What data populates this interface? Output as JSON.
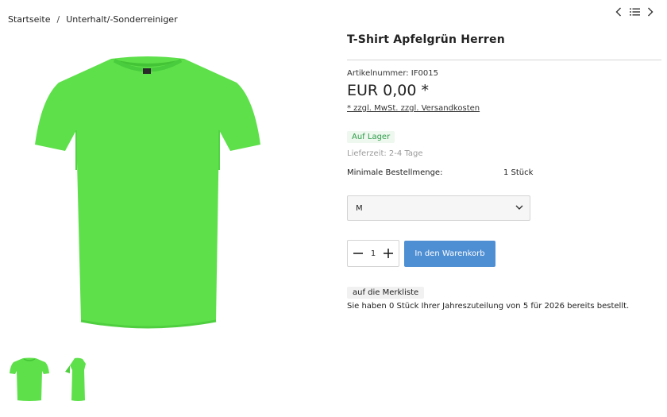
{
  "breadcrumb": {
    "home": "Startseite",
    "separator": "/",
    "category": "Unterhalt/-Sonderreiniger"
  },
  "nav": {
    "prev_icon": "chevron-left-icon",
    "list_icon": "list-icon",
    "next_icon": "chevron-right-icon"
  },
  "product": {
    "title": "T-Shirt Apfelgrün Herren",
    "sku_label": "Artikelnummer: IF0015",
    "price": "EUR 0,00 *",
    "tax_note": "* zzgl. MwSt. zzgl. Versandkosten",
    "stock_status": "Auf Lager",
    "delivery_time": "Lieferzeit: 2-4 Tage",
    "min_order_label": "Minimale Bestellmenge:",
    "min_order_value": "1 Stück",
    "color": "#5ee04a"
  },
  "size_select": {
    "selected": "M"
  },
  "quantity": {
    "value": "1"
  },
  "buttons": {
    "add_to_cart": "In den Warenkorb",
    "wishlist": "auf die Merkliste"
  },
  "allocation_note": "Sie haben 0 Stück Ihrer Jahreszuteilung von 5 für 2026 bereits bestellt.",
  "colors": {
    "accent": "#4e8ed3",
    "stock_green": "#2f9d4a"
  }
}
